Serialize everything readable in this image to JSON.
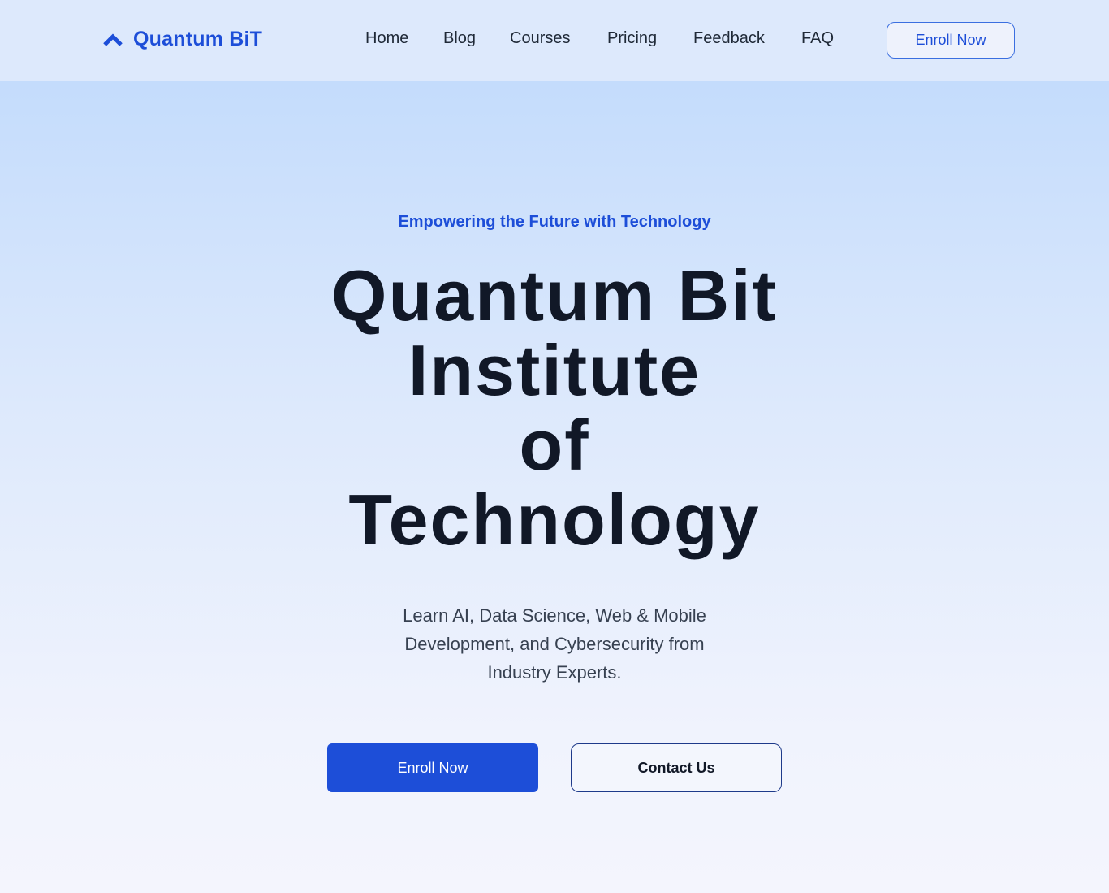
{
  "nav": {
    "logo_icon": "chevron-up-icon",
    "logo_text": "Quantum BiT",
    "links": [
      "Home",
      "Blog",
      "Courses",
      "Pricing",
      "Feedback",
      "FAQ"
    ],
    "enroll_label": "Enroll Now"
  },
  "hero": {
    "tagline": "Empowering the Future with Technology",
    "title_lines": [
      "Quantum Bit",
      "Institute",
      "of",
      "Technology"
    ],
    "subtitle": "Learn AI, Data Science, Web & Mobile Development, and Cybersecurity from Industry Experts.",
    "primary_button": "Enroll Now",
    "secondary_button": "Contact Us"
  },
  "colors": {
    "accent": "#1d4ed8",
    "heading": "#111827",
    "nav_bg": "#dde9fc",
    "hero_top": "#c4dcfc",
    "hero_bottom": "#f4f5fd"
  }
}
